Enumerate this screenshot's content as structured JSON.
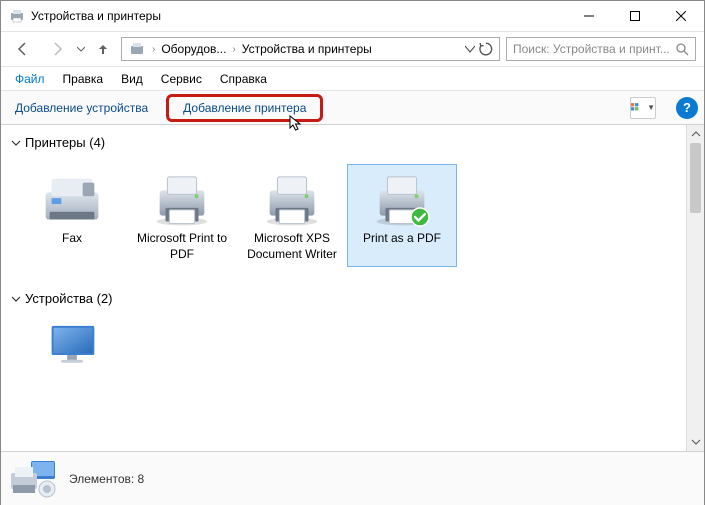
{
  "window": {
    "title": "Устройства и принтеры"
  },
  "nav": {
    "crumb1": "Оборудов...",
    "crumb2": "Устройства и принтеры"
  },
  "search": {
    "placeholder": "Поиск: Устройства и принт..."
  },
  "menu": {
    "file": "Файл",
    "edit": "Правка",
    "view": "Вид",
    "svc": "Сервис",
    "help": "Справка"
  },
  "toolbar": {
    "add_device": "Добавление устройства",
    "add_printer": "Добавление принтера"
  },
  "sections": {
    "printers_label": "Принтеры (4)",
    "devices_label": "Устройства (2)"
  },
  "printers": [
    {
      "label": "Fax"
    },
    {
      "label": "Microsoft Print to PDF"
    },
    {
      "label": "Microsoft XPS Document Writer"
    },
    {
      "label": "Print as a PDF"
    }
  ],
  "status": {
    "text": "Элементов: 8"
  }
}
